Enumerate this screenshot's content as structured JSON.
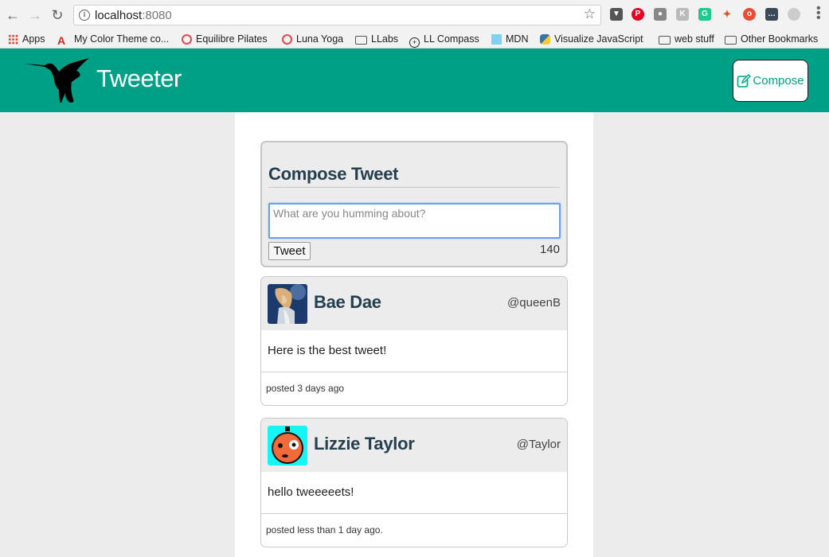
{
  "browser": {
    "url_host": "localhost",
    "url_port": ":8080"
  },
  "bookmarks": [
    {
      "label": "Apps",
      "icon": "apps-grid-icon"
    },
    {
      "label": "My Color Theme co...",
      "icon": "adobe-icon"
    },
    {
      "label": "Equilibre Pilates",
      "icon": "opera-ring-icon"
    },
    {
      "label": "Luna Yoga",
      "icon": "opera-ring-icon"
    },
    {
      "label": "LLabs",
      "icon": "folder-icon"
    },
    {
      "label": "LL Compass",
      "icon": "compass-icon"
    },
    {
      "label": "MDN",
      "icon": "mdn-icon"
    },
    {
      "label": "Visualize JavaScript",
      "icon": "python-icon"
    },
    {
      "label": "web stuff",
      "icon": "folder-icon"
    },
    {
      "label": "Other Bookmarks",
      "icon": "folder-icon"
    }
  ],
  "header": {
    "brand": "Tweeter",
    "compose_label": "Compose",
    "color": "#00a087"
  },
  "compose": {
    "title": "Compose Tweet",
    "placeholder": "What are you humming about?",
    "button_label": "Tweet",
    "counter": "140"
  },
  "tweets": [
    {
      "name": "Bae Dae",
      "handle": "@queenB",
      "text": "Here is the best tweet!",
      "posted": "posted 3 days ago"
    },
    {
      "name": "Lizzie Taylor",
      "handle": "@Taylor",
      "text": "hello tweeeeets!",
      "posted": "posted less than 1 day ago."
    }
  ]
}
